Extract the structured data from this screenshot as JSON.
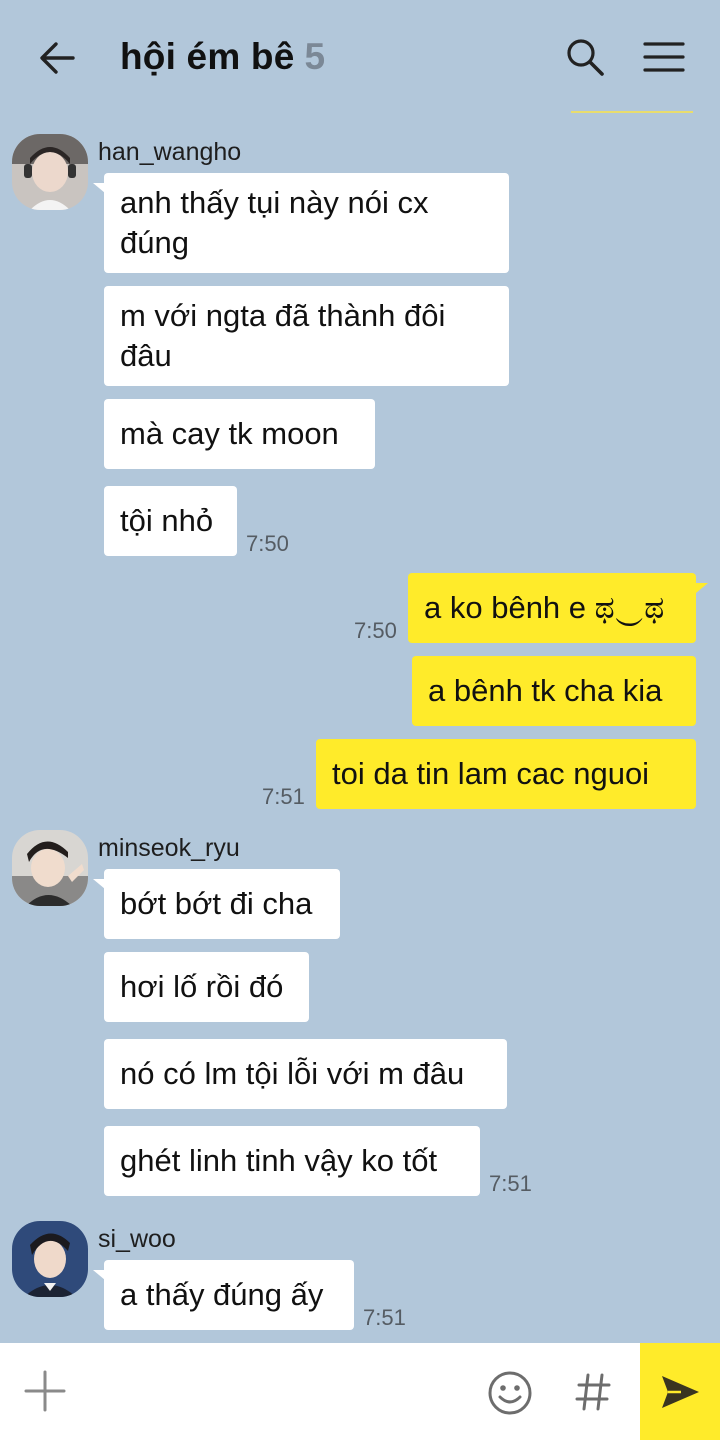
{
  "header": {
    "title": "hội ém bê",
    "member_count": "5"
  },
  "icons": {
    "back": "arrow-left-icon",
    "search": "magnifier-icon",
    "menu": "hamburger-icon",
    "plus": "plus-icon",
    "emoji": "smiley-icon",
    "hashtag": "hashtag-icon",
    "send": "paper-plane-icon"
  },
  "colors": {
    "background": "#b2c7da",
    "outgoing_bubble": "#ffeb2a",
    "incoming_bubble": "#ffffff",
    "send_button": "#ffeb2a"
  },
  "chat": {
    "group1": {
      "sender": "han_wangho",
      "messages": [
        "anh thấy tụi này nói cx đúng",
        "m với ngta đã thành đôi đâu",
        "mà cay tk moon",
        "tội nhỏ"
      ],
      "time": "7:50"
    },
    "outgoing": {
      "messages": [
        "a ko bênh e ಥ‿ಥ",
        "a bênh tk cha kia",
        "toi da tin lam cac nguoi"
      ],
      "time1": "7:50",
      "time2": "7:51"
    },
    "group2": {
      "sender": "minseok_ryu",
      "messages": [
        "bớt bớt đi cha",
        "hơi lố rồi đó",
        "nó có lm tội lỗi với m đâu",
        "ghét linh tinh vậy ko tốt"
      ],
      "time": "7:51"
    },
    "group3": {
      "sender": "si_woo",
      "messages": [
        "a thấy đúng ấy"
      ],
      "time": "7:51"
    }
  },
  "composer": {
    "placeholder": "",
    "value": ""
  }
}
